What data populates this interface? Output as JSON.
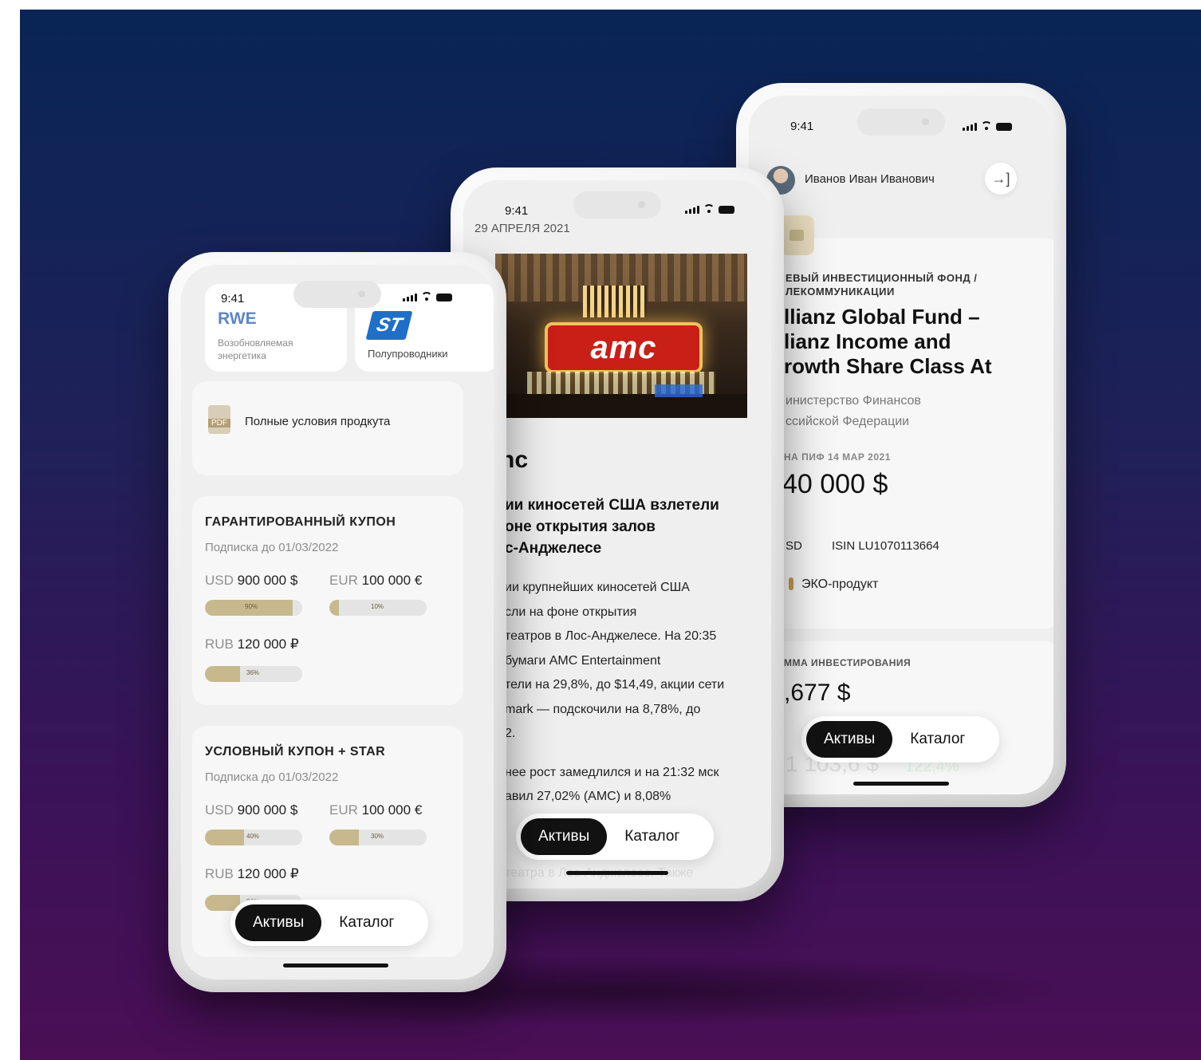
{
  "colors": {
    "bg_top": "#082556",
    "bg_bottom": "#4a0f55",
    "accent_gold": "#c7b98d",
    "tab_active": "#121212"
  },
  "tabbar": {
    "assets": "Активы",
    "catalog": "Каталог"
  },
  "phone_left": {
    "time": "9:41",
    "company1": {
      "logo": "RWE",
      "sector": "Возобновляемая энергетика"
    },
    "company2": {
      "logo": "ST",
      "sector": "Полупроводники"
    },
    "pdf": {
      "badge": "PDF",
      "label": "Полные условия продкута"
    },
    "product1": {
      "title": "Гарантированный купон",
      "subscription": "Подписка до 01/03/2022",
      "usd": {
        "currency": "USD",
        "amount": "900 000 $",
        "percent": "90%",
        "fraction": 0.9
      },
      "eur": {
        "currency": "EUR",
        "amount": "100 000 €",
        "percent": "10%",
        "fraction": 0.1
      },
      "rub": {
        "currency": "RUB",
        "amount": "120 000 ₽",
        "percent": "36%",
        "fraction": 0.36
      }
    },
    "product2": {
      "title": "Условный купон + STAR",
      "subscription": "Подписка до 01/03/2022",
      "usd": {
        "currency": "USD",
        "amount": "900 000 $",
        "percent": "40%",
        "fraction": 0.4
      },
      "eur": {
        "currency": "EUR",
        "amount": "100 000 €",
        "percent": "30%",
        "fraction": 0.3
      },
      "rub": {
        "currency": "RUB",
        "amount": "120 000 ₽",
        "percent": "36%",
        "fraction": 0.36
      }
    }
  },
  "phone_middle": {
    "time": "9:41",
    "date": "29 АПРЕЛЯ 2021",
    "image_sign": "amc",
    "ticker": "nc",
    "headline": "ии киносетей США взлетели\nоне открытия залов\nс-Анджелесе",
    "body1": "ии крупнейших киносетей США\nсли на фоне открытия\nтеатров в Лос-Анджелесе. На 20:35\nбумаги AMC Entertainment\nтели на 29,8%, до $14,49, акции сети\nmark — подскочили на 8,78%, до\n2.",
    "body2": "нее рост замедлился и на 21:32 мск\nавил 27,02% (AMC) и 8,08%",
    "body3_faded": "театра в Лос-Анджелесе. Также"
  },
  "phone_right": {
    "time": "9:41",
    "user_name": "Иванов Иван Иванович",
    "fund_type": "ЕВЫЙ ИНВЕСТИЦИОННЫЙ ФОНД /\nЛЕКОММУНИКАЦИИ",
    "fund_name": "llianz Global Fund –\nlianz Income and\nrowth Share Class At",
    "issuer": "инистерство Финансов\nссийской Федерации",
    "price_label": "НА ПИФ 14 МАР 2021",
    "price_value": "40 000 $",
    "currency": "SD",
    "isin": "ISIN LU1070113664",
    "eco_label": "ЭКО-продукт",
    "invest_label": "ММА ИНВЕСТИРОВАНИЯ",
    "invest_value": ",677 $",
    "faded_value": "1 103,6 $",
    "faded_change": "122,4%"
  }
}
